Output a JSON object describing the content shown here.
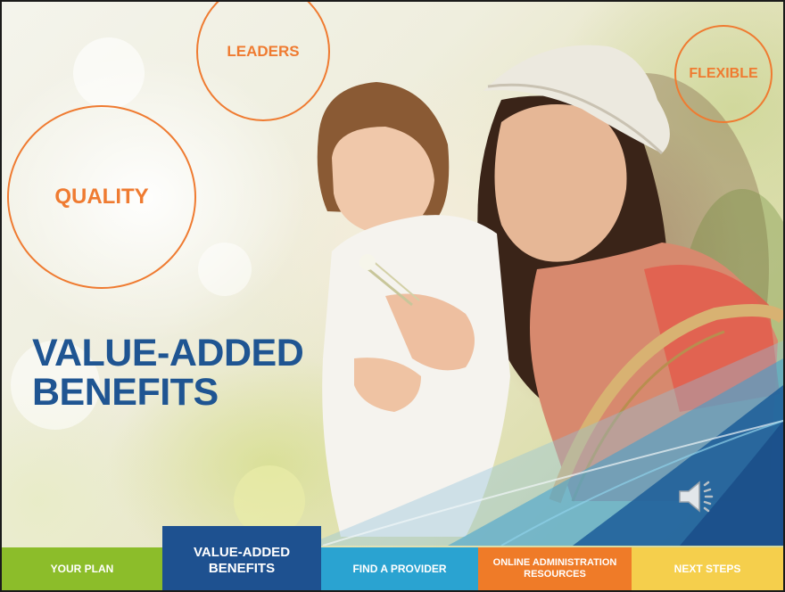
{
  "slide": {
    "circles": {
      "quality": "QUALITY",
      "leaders": "LEADERS",
      "flexible": "FLEXIBLE"
    },
    "headline": {
      "line1": "VALUE-ADDED",
      "line2": "BENEFITS"
    },
    "nav": {
      "tabs": [
        {
          "line1": "YOUR PLAN",
          "color": "#8cbd2a"
        },
        {
          "line1": "VALUE-ADDED",
          "line2": "BENEFITS",
          "color": "#1e5190",
          "active": true
        },
        {
          "line1": "FIND A PROVIDER",
          "color": "#2aa3d1"
        },
        {
          "line1": "ONLINE ADMINISTRATION",
          "line2": "RESOURCES",
          "color": "#ef7b28"
        },
        {
          "line1": "NEXT STEPS",
          "color": "#f5cf4c"
        }
      ]
    },
    "icons": {
      "audio": "speaker-icon"
    },
    "colors": {
      "accent_orange": "#ef7b31",
      "headline_blue": "#1f5592"
    }
  }
}
